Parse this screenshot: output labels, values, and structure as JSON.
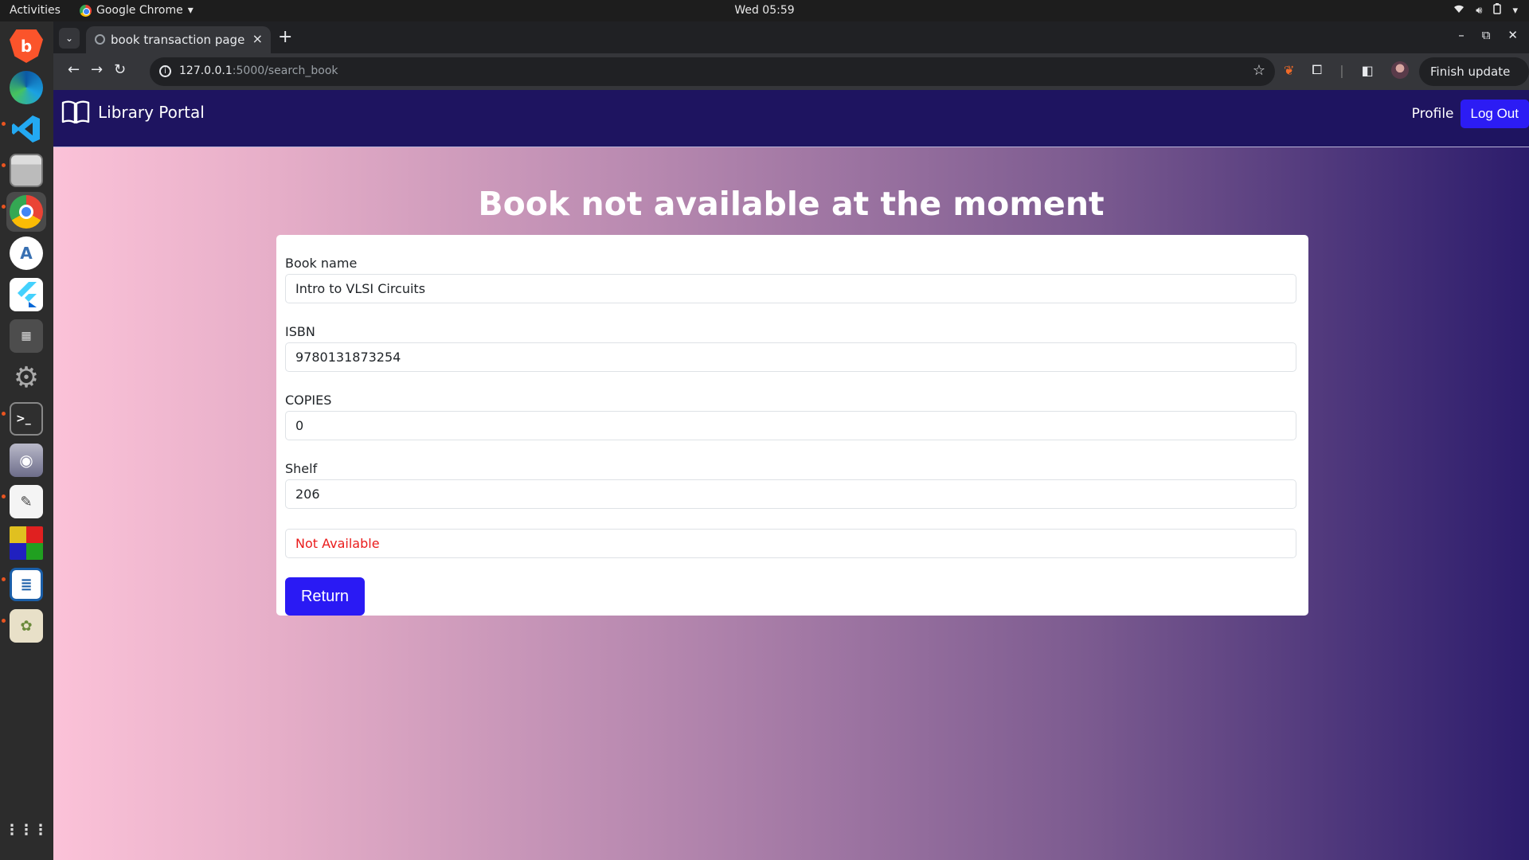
{
  "system": {
    "activities": "Activities",
    "app_name": "Google Chrome",
    "clock": "Wed 05:59"
  },
  "browser": {
    "tab_title": "book transaction page",
    "url_host": "127.0.0.1",
    "url_path": ":5000/search_book",
    "finish_update": "Finish update"
  },
  "portal": {
    "brand": "Library Portal",
    "nav_profile": "Profile",
    "nav_logout": "Log Out"
  },
  "page": {
    "title": "Book not available at the moment",
    "fields": [
      {
        "label": "Book name",
        "value": "Intro to VLSI Circuits"
      },
      {
        "label": "ISBN",
        "value": "9780131873254"
      },
      {
        "label": "COPIES",
        "value": "0"
      },
      {
        "label": "Shelf",
        "value": "206"
      }
    ],
    "status_value": "Not Available",
    "return_label": "Return"
  },
  "colors": {
    "nav_bg": "#1e1460",
    "button_bg": "#2a1af4",
    "status_text": "#ea1b1b",
    "gradient_start": "#fbc2d8",
    "gradient_end": "#2c1c6c"
  }
}
